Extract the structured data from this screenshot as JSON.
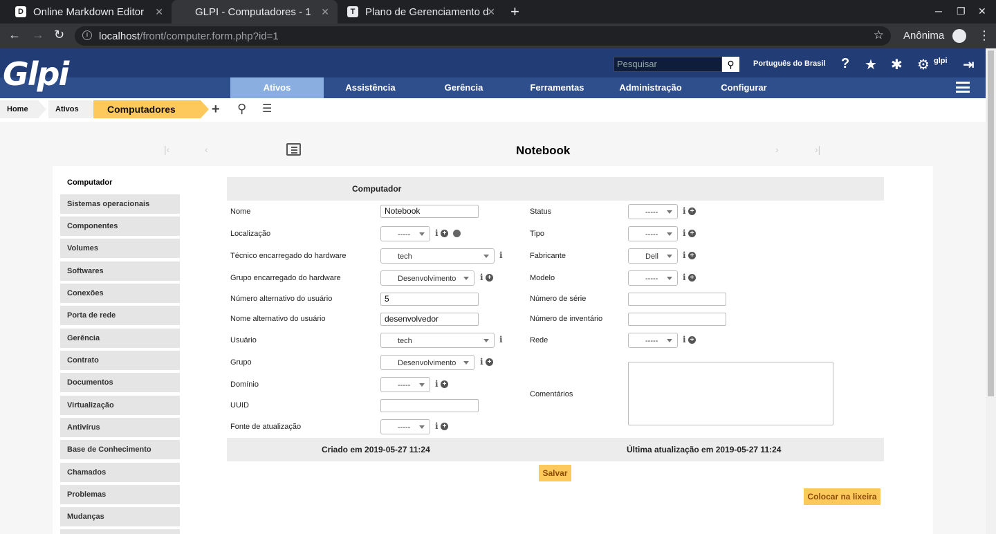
{
  "browser": {
    "tabs": [
      {
        "title": "Online Markdown Editor",
        "favicon": "D"
      },
      {
        "title": "GLPI - Computadores - 1",
        "favicon": ""
      },
      {
        "title": "Plano de Gerenciamento d",
        "favicon": "T"
      }
    ],
    "url_host": "localhost",
    "url_path": "/front/computer.form.php?id=1",
    "profile": "Anônima"
  },
  "header": {
    "logo": "Glpi",
    "search_placeholder": "Pesquisar",
    "language": "Português do Brasil",
    "user": "glpi"
  },
  "menu": [
    "Ativos",
    "Assistência",
    "Gerência",
    "Ferramentas",
    "Administração",
    "Configurar"
  ],
  "breadcrumb": [
    "Home",
    "Ativos",
    "Computadores"
  ],
  "page_title": "Notebook",
  "sidebar": [
    "Computador",
    "Sistemas operacionais",
    "Componentes",
    "Volumes",
    "Softwares",
    "Conexões",
    "Porta de rede",
    "Gerência",
    "Contrato",
    "Documentos",
    "Virtualização",
    "Antivírus",
    "Base de Conhecimento",
    "Chamados",
    "Problemas",
    "Mudanças"
  ],
  "form": {
    "section_title": "Computador",
    "left": {
      "nome": {
        "label": "Nome",
        "value": "Notebook"
      },
      "localizacao": {
        "label": "Localização",
        "value": "-----"
      },
      "tecnico": {
        "label": "Técnico encarregado do hardware",
        "value": "tech"
      },
      "grupo_hw": {
        "label": "Grupo encarregado do hardware",
        "value": "Desenvolvimento"
      },
      "num_alt": {
        "label": "Número alternativo do usuário",
        "value": "5"
      },
      "nome_alt": {
        "label": "Nome alternativo do usuário",
        "value": "desenvolvedor"
      },
      "usuario": {
        "label": "Usuário",
        "value": "tech"
      },
      "grupo": {
        "label": "Grupo",
        "value": "Desenvolvimento"
      },
      "dominio": {
        "label": "Domínio",
        "value": "-----"
      },
      "uuid": {
        "label": "UUID",
        "value": ""
      },
      "fonte": {
        "label": "Fonte de atualização",
        "value": "-----"
      }
    },
    "right": {
      "status": {
        "label": "Status",
        "value": "-----"
      },
      "tipo": {
        "label": "Tipo",
        "value": "-----"
      },
      "fabricante": {
        "label": "Fabricante",
        "value": "Dell"
      },
      "modelo": {
        "label": "Modelo",
        "value": "-----"
      },
      "serie": {
        "label": "Número de série",
        "value": ""
      },
      "inventario": {
        "label": "Número de inventário",
        "value": ""
      },
      "rede": {
        "label": "Rede",
        "value": "-----"
      },
      "comentarios": {
        "label": "Comentários",
        "value": ""
      }
    },
    "created": "Criado em 2019-05-27 11:24",
    "updated": "Última atualização em 2019-05-27 11:24",
    "save_label": "Salvar",
    "trash_label": "Colocar na lixeira"
  },
  "colors": {
    "header": "#223c75",
    "menu": "#2f4e8c",
    "active_menu": "#8aaee0",
    "accent": "#fec95c"
  }
}
